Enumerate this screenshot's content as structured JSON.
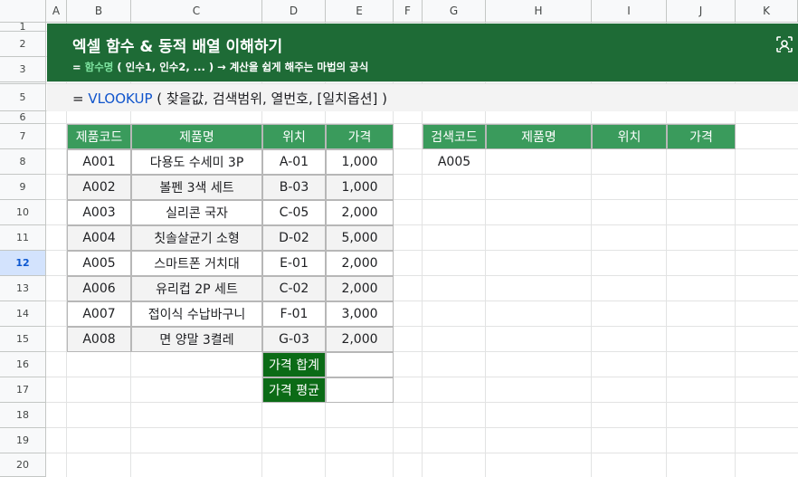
{
  "columns": [
    "A",
    "B",
    "C",
    "D",
    "E",
    "F",
    "G",
    "H",
    "I",
    "J",
    "K"
  ],
  "rows": [
    "1",
    "2",
    "3",
    "",
    "5",
    "6",
    "7",
    "8",
    "9",
    "10",
    "11",
    "12",
    "13",
    "14",
    "15",
    "16",
    "17",
    "18",
    "19",
    "20"
  ],
  "selected_row": "12",
  "banner": {
    "title": "엑셀 함수 & 동적 배열 이해하기",
    "sub_prefix": "= ",
    "sub_highlight": "함수명",
    "sub_rest": " ( 인수1, 인수2, ... )  → 계산을 쉽게 해주는 마법의 공식"
  },
  "formula": {
    "prefix": "= ",
    "function": "VLOOKUP",
    "args": " ( 찾을값, 검색범위, 열번호, [일치옵션] )"
  },
  "product_table": {
    "headers": [
      "제품코드",
      "제품명",
      "위치",
      "가격"
    ],
    "rows": [
      [
        "A001",
        "다용도 수세미 3P",
        "A-01",
        "1,000"
      ],
      [
        "A002",
        "볼펜 3색 세트",
        "B-03",
        "1,000"
      ],
      [
        "A003",
        "실리콘 국자",
        "C-05",
        "2,000"
      ],
      [
        "A004",
        "칫솔살균기 소형",
        "D-02",
        "5,000"
      ],
      [
        "A005",
        "스마트폰 거치대",
        "E-01",
        "2,000"
      ],
      [
        "A006",
        "유리컵 2P 세트",
        "C-02",
        "2,000"
      ],
      [
        "A007",
        "접이식 수납바구니",
        "F-01",
        "3,000"
      ],
      [
        "A008",
        "면 양말 3켤레",
        "G-03",
        "2,000"
      ]
    ],
    "sum_label": "가격 합계",
    "sum_value": "",
    "avg_label": "가격 평균",
    "avg_value": ""
  },
  "search_table": {
    "headers": [
      "검색코드",
      "제품명",
      "위치",
      "가격"
    ],
    "query": "A005"
  },
  "colors": {
    "banner": "#1e6b36",
    "header": "#3a9b5c",
    "summary_label": "#0b6b16",
    "function_blue": "#1155cc",
    "highlight": "#7ee3a0"
  },
  "icons": {
    "banner_action": "camera-focus-icon"
  }
}
